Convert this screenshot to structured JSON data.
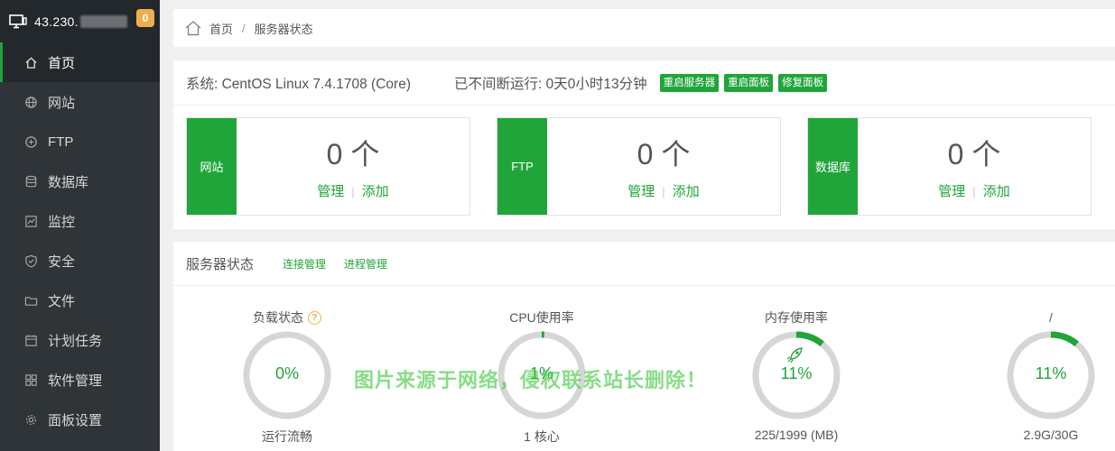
{
  "sidebar": {
    "ip": "43.230.",
    "badge": "0",
    "items": [
      {
        "label": "首页",
        "icon": "home-icon"
      },
      {
        "label": "网站",
        "icon": "globe-icon"
      },
      {
        "label": "FTP",
        "icon": "ftp-icon"
      },
      {
        "label": "数据库",
        "icon": "database-icon"
      },
      {
        "label": "监控",
        "icon": "monitor-chart-icon"
      },
      {
        "label": "安全",
        "icon": "shield-icon"
      },
      {
        "label": "文件",
        "icon": "folder-icon"
      },
      {
        "label": "计划任务",
        "icon": "calendar-icon"
      },
      {
        "label": "软件管理",
        "icon": "grid-icon"
      },
      {
        "label": "面板设置",
        "icon": "gear-icon"
      }
    ]
  },
  "breadcrumb": {
    "home": "首页",
    "current": "服务器状态"
  },
  "system": {
    "os": "系统: CentOS Linux 7.4.1708 (Core)",
    "uptime": "已不间断运行: 0天0小时13分钟",
    "buttons": {
      "restart_server": "重启服务器",
      "restart_panel": "重启面板",
      "repair_panel": "修复面板"
    }
  },
  "cards": [
    {
      "tag": "网站",
      "count": "0 个",
      "manage": "管理",
      "add": "添加"
    },
    {
      "tag": "FTP",
      "count": "0 个",
      "manage": "管理",
      "add": "添加"
    },
    {
      "tag": "数据库",
      "count": "0 个",
      "manage": "管理",
      "add": "添加"
    }
  ],
  "status": {
    "title": "服务器状态",
    "conn_link": "连接管理",
    "proc_link": "进程管理",
    "gauges": [
      {
        "title": "负载状态",
        "percent": "0%",
        "value": 0,
        "sub": "运行流畅"
      },
      {
        "title": "CPU使用率",
        "percent": "1%",
        "value": 1,
        "sub": "1 核心"
      },
      {
        "title": "内存使用率",
        "percent": "11%",
        "value": 11,
        "sub": "225/1999 (MB)"
      },
      {
        "title": "/",
        "percent": "11%",
        "value": 11,
        "sub": "2.9G/30G"
      }
    ]
  },
  "colors": {
    "accent": "#20a53a",
    "badge": "#f0ad4e",
    "sidebar": "#2f3438"
  },
  "watermark": "图片来源于网络，侵权联系站长删除！"
}
